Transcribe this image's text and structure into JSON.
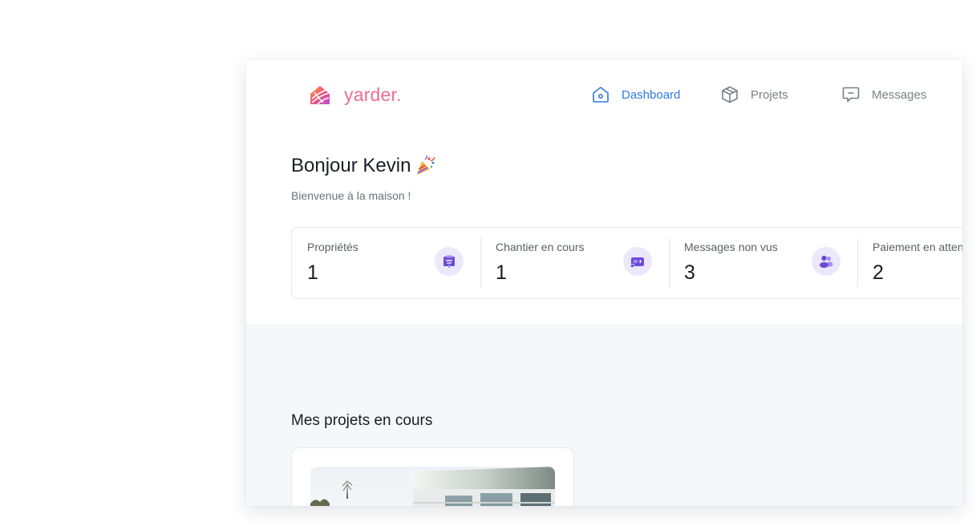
{
  "app": {
    "logo_text": "yarder.",
    "brand_color": "#ef6c8f",
    "accent_color": "#2f7be0"
  },
  "nav": {
    "items": [
      {
        "label": "Dashboard",
        "icon": "home-icon",
        "active": true
      },
      {
        "label": "Projets",
        "icon": "box-icon",
        "active": false
      },
      {
        "label": "Messages",
        "icon": "message-icon",
        "active": false
      }
    ]
  },
  "greeting": {
    "title": "Bonjour Kevin",
    "emoji_icon": "party-popper-icon",
    "subtitle": "Bienvenue à la maison !"
  },
  "stats": [
    {
      "label": "Propriétés",
      "value": "1",
      "icon": "id-badge-icon"
    },
    {
      "label": "Chantier en cours",
      "value": "1",
      "icon": "video-camera-icon"
    },
    {
      "label": "Messages non vus",
      "value": "3",
      "icon": "users-icon"
    },
    {
      "label": "Paiement en attente",
      "value": "2",
      "icon": "payment-icon"
    }
  ],
  "projects": {
    "section_title": "Mes projets en cours",
    "items": [
      {
        "image_icon": "modern-house-photo"
      }
    ]
  }
}
